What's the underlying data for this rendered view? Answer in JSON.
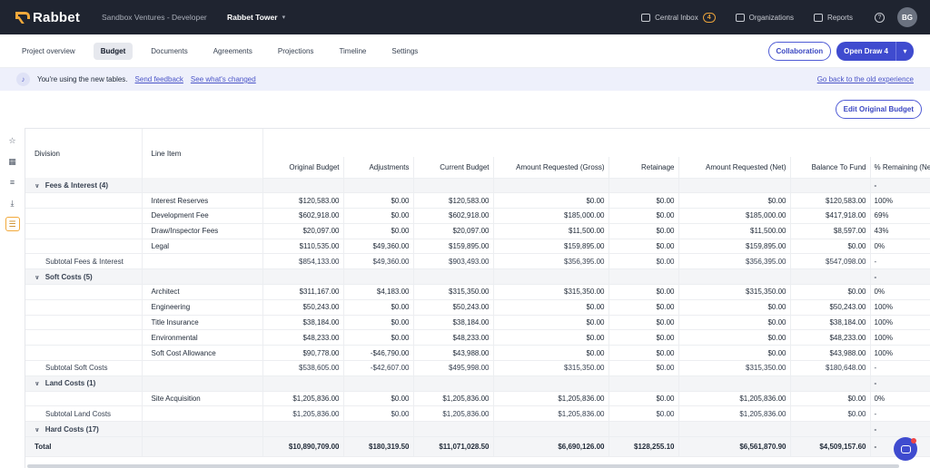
{
  "topbar": {
    "logo": "Rabbet",
    "org": "Sandbox Ventures - Developer",
    "project": "Rabbet Tower",
    "links": [
      {
        "label": "Central Inbox",
        "badge": "4"
      },
      {
        "label": "Organizations"
      },
      {
        "label": "Reports"
      }
    ],
    "avatar": "BG"
  },
  "tabs": [
    {
      "label": "Project overview",
      "active": false
    },
    {
      "label": "Budget",
      "active": true
    },
    {
      "label": "Documents",
      "active": false
    },
    {
      "label": "Agreements",
      "active": false
    },
    {
      "label": "Projections",
      "active": false
    },
    {
      "label": "Timeline",
      "active": false
    },
    {
      "label": "Settings",
      "active": false
    }
  ],
  "actions": {
    "collaboration": "Collaboration",
    "open_draw": "Open Draw 4"
  },
  "notice": {
    "text": "You're using the new tables.",
    "feedback": "Send feedback",
    "changed": "See what's changed",
    "old": "Go back to the old experience"
  },
  "edit_budget": "Edit Original Budget",
  "table": {
    "columns": [
      "Division",
      "Line Item",
      "Original Budget",
      "Adjustments",
      "Current Budget",
      "Amount Requested (Gross)",
      "Retainage",
      "Amount Requested (Net)",
      "Balance To Fund",
      "% Remaining (Net)"
    ],
    "rows": [
      {
        "type": "group",
        "label": "Fees & Interest (4)",
        "pct": "-"
      },
      {
        "type": "line",
        "item": "Interest Reserves",
        "vals": [
          "$120,583.00",
          "$0.00",
          "$120,583.00",
          "$0.00",
          "$0.00",
          "$0.00",
          "$120,583.00",
          "100%"
        ]
      },
      {
        "type": "line",
        "item": "Development Fee",
        "vals": [
          "$602,918.00",
          "$0.00",
          "$602,918.00",
          "$185,000.00",
          "$0.00",
          "$185,000.00",
          "$417,918.00",
          "69%"
        ]
      },
      {
        "type": "line",
        "item": "Draw/Inspector Fees",
        "vals": [
          "$20,097.00",
          "$0.00",
          "$20,097.00",
          "$11,500.00",
          "$0.00",
          "$11,500.00",
          "$8,597.00",
          "43%"
        ]
      },
      {
        "type": "line",
        "item": "Legal",
        "vals": [
          "$110,535.00",
          "$49,360.00",
          "$159,895.00",
          "$159,895.00",
          "$0.00",
          "$159,895.00",
          "$0.00",
          "0%"
        ]
      },
      {
        "type": "subtotal",
        "label": "Subtotal Fees & Interest",
        "vals": [
          "$854,133.00",
          "$49,360.00",
          "$903,493.00",
          "$356,395.00",
          "$0.00",
          "$356,395.00",
          "$547,098.00",
          "-"
        ]
      },
      {
        "type": "group",
        "label": "Soft Costs (5)",
        "pct": "-"
      },
      {
        "type": "line",
        "item": "Architect",
        "vals": [
          "$311,167.00",
          "$4,183.00",
          "$315,350.00",
          "$315,350.00",
          "$0.00",
          "$315,350.00",
          "$0.00",
          "0%"
        ]
      },
      {
        "type": "line",
        "item": "Engineering",
        "vals": [
          "$50,243.00",
          "$0.00",
          "$50,243.00",
          "$0.00",
          "$0.00",
          "$0.00",
          "$50,243.00",
          "100%"
        ]
      },
      {
        "type": "line",
        "item": "Title Insurance",
        "vals": [
          "$38,184.00",
          "$0.00",
          "$38,184.00",
          "$0.00",
          "$0.00",
          "$0.00",
          "$38,184.00",
          "100%"
        ]
      },
      {
        "type": "line",
        "item": "Environmental",
        "vals": [
          "$48,233.00",
          "$0.00",
          "$48,233.00",
          "$0.00",
          "$0.00",
          "$0.00",
          "$48,233.00",
          "100%"
        ]
      },
      {
        "type": "line",
        "item": "Soft Cost Allowance",
        "vals": [
          "$90,778.00",
          "-$46,790.00",
          "$43,988.00",
          "$0.00",
          "$0.00",
          "$0.00",
          "$43,988.00",
          "100%"
        ]
      },
      {
        "type": "subtotal",
        "label": "Subtotal Soft Costs",
        "vals": [
          "$538,605.00",
          "-$42,607.00",
          "$495,998.00",
          "$315,350.00",
          "$0.00",
          "$315,350.00",
          "$180,648.00",
          "-"
        ]
      },
      {
        "type": "group",
        "label": "Land Costs (1)",
        "pct": "-"
      },
      {
        "type": "line",
        "item": "Site Acquisition",
        "vals": [
          "$1,205,836.00",
          "$0.00",
          "$1,205,836.00",
          "$1,205,836.00",
          "$0.00",
          "$1,205,836.00",
          "$0.00",
          "0%"
        ]
      },
      {
        "type": "subtotal",
        "label": "Subtotal Land Costs",
        "vals": [
          "$1,205,836.00",
          "$0.00",
          "$1,205,836.00",
          "$1,205,836.00",
          "$0.00",
          "$1,205,836.00",
          "$0.00",
          "-"
        ]
      },
      {
        "type": "group",
        "label": "Hard Costs (17)",
        "pct": "-"
      }
    ],
    "total": {
      "label": "Total",
      "vals": [
        "$10,890,709.00",
        "$180,319.50",
        "$11,071,028.50",
        "$6,690,126.00",
        "$128,255.10",
        "$6,561,870.90",
        "$4,509,157.60",
        "-"
      ]
    }
  }
}
